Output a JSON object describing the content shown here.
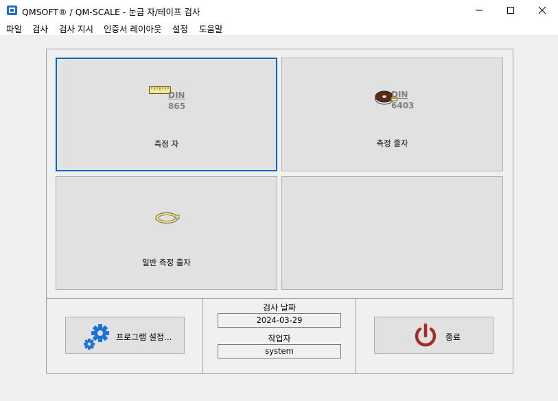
{
  "window": {
    "title": "QMSOFT® / QM-SCALE - 눈금 자/테이프 검사"
  },
  "menu": {
    "items": [
      "파일",
      "검사",
      "검사 지시",
      "인증서 레이아웃",
      "설정",
      "도움말"
    ]
  },
  "tiles": [
    {
      "label": "측정 자",
      "icon": "ruler-icon",
      "din": "DIN",
      "din_no": "865",
      "focused": true
    },
    {
      "label": "측정 줄자",
      "icon": "tape-measure-icon",
      "din": "DIN",
      "din_no": "6403",
      "focused": false
    },
    {
      "label": "일반 측정 줄자",
      "icon": "soft-tape-icon",
      "focused": false
    },
    {
      "label": "",
      "icon": "",
      "focused": false
    }
  ],
  "footer": {
    "settings_label": "프로그램 설정...",
    "date_caption": "검사 날짜",
    "date_value": "2024-03-29",
    "worker_caption": "작업자",
    "worker_value": "system",
    "exit_label": "종료"
  },
  "colors": {
    "accent": "#0067c0",
    "gear": "#1a73d9",
    "power": "#a52a2a",
    "ruler": "#f3e7a0"
  }
}
